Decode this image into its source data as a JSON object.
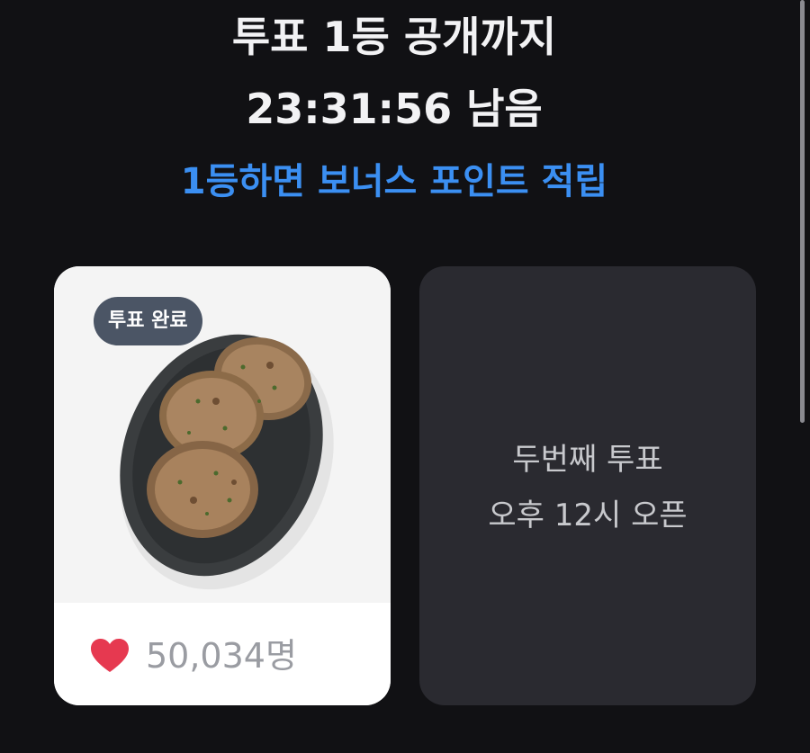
{
  "header": {
    "line1": "투표 1등 공개까지",
    "line2": "23:31:56 남음",
    "bonus": "1등하면 보너스 포인트 적립"
  },
  "cards": {
    "first": {
      "badge": "투표 완료",
      "image_icon": "food-photo-meat-patties",
      "like_icon": "heart-icon",
      "like_count": "50,034명"
    },
    "second": {
      "line1": "두번째 투표",
      "line2": "오후 12시 오픈"
    }
  },
  "colors": {
    "background": "#111114",
    "accent": "#3b8ff2",
    "badge": "#4b5565",
    "heart": "#e63950",
    "locked_card": "#2a2a30"
  }
}
